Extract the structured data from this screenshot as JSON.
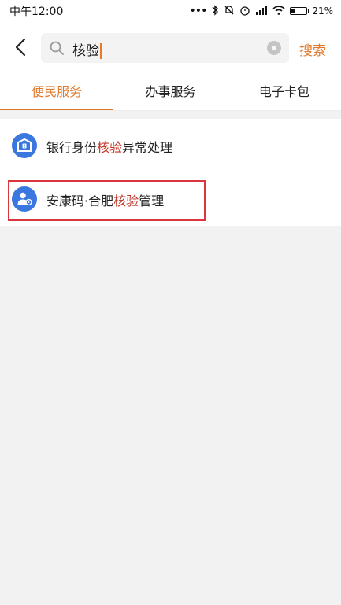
{
  "status_bar": {
    "time": "中午12:00",
    "signal_text": "..ll",
    "battery_percent_label": "21%",
    "battery_level": 0.21
  },
  "search": {
    "query": "核验",
    "button_label": "搜索",
    "icons": {
      "back": "back-arrow-icon",
      "search": "search-icon",
      "clear": "clear-icon"
    }
  },
  "tabs": [
    {
      "label": "便民服务",
      "active": true
    },
    {
      "label": "办事服务",
      "active": false
    },
    {
      "label": "电子卡包",
      "active": false
    }
  ],
  "results": [
    {
      "prefix": "银行身份",
      "highlight": "核验",
      "suffix": "异常处理",
      "icon": "bank-icon"
    },
    {
      "prefix": "安康码·合肥",
      "highlight": "核验",
      "suffix": "管理",
      "icon": "user-location-icon",
      "outlined": true
    }
  ],
  "colors": {
    "accent": "#e0792b",
    "highlight_text": "#c0392b",
    "icon_blue": "#3a78e0",
    "annotation_red": "#d9363e"
  }
}
